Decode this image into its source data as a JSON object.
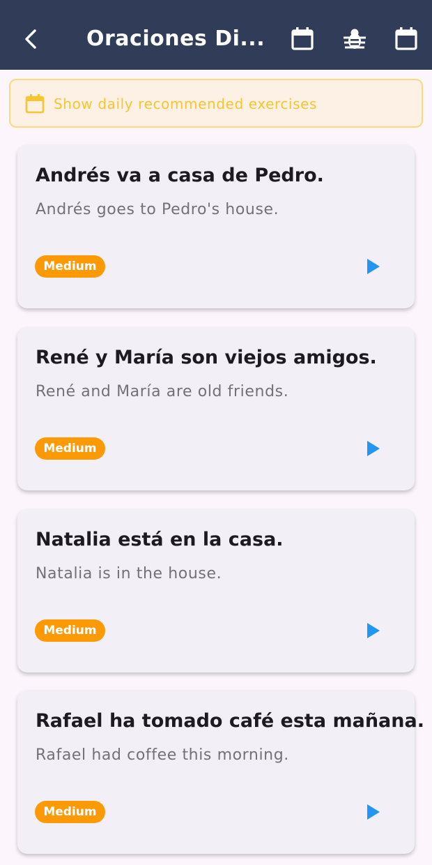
{
  "appbar": {
    "title": "Oraciones Di...",
    "back_icon": "back-arrow-icon",
    "actions": [
      "calendar-icon",
      "bug-icon",
      "calendar-icon"
    ]
  },
  "banner": {
    "icon": "calendar-icon",
    "text": "Show daily recommended exercises"
  },
  "cards": [
    {
      "sentence": "Andrés va a casa de Pedro.",
      "translation": "Andrés goes to Pedro's house.",
      "difficulty": "Medium"
    },
    {
      "sentence": "René y María son viejos amigos.",
      "translation": "René and María are old friends.",
      "difficulty": "Medium"
    },
    {
      "sentence": "Natalia está en la casa.",
      "translation": "Natalia is in the house.",
      "difficulty": "Medium"
    },
    {
      "sentence": "Rafael ha tomado café esta mañana.",
      "translation": "Rafael had coffee this morning.",
      "difficulty": "Medium"
    }
  ],
  "colors": {
    "appbar": "#313d58",
    "badge": "#fc9a06",
    "play": "#2196f3",
    "banner_text": "#f9c52f"
  }
}
